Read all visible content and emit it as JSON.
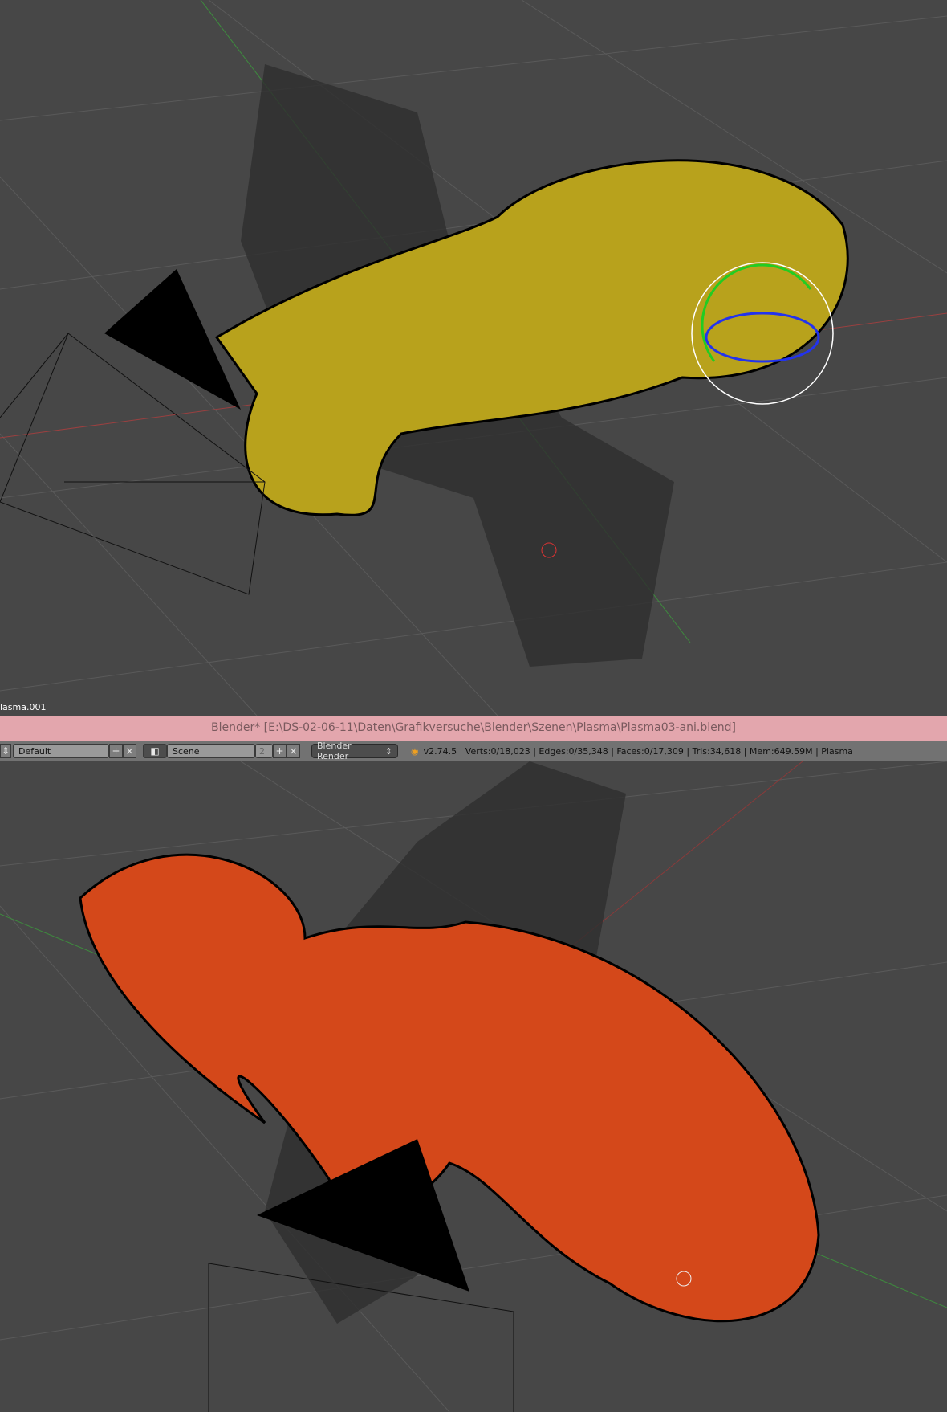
{
  "viewport_top": {
    "object_label": "lasma.001"
  },
  "titlebar": {
    "title": "Blender* [E:\\DS-02-06-11\\Daten\\Grafikversuche\\Blender\\Szenen\\Plasma\\Plasma03-ani.blend]"
  },
  "infobar": {
    "screen_layout": "Default",
    "scene": "Scene",
    "scene_users": "2",
    "render_engine": "Blender Render",
    "stats": "v2.74.5 | Verts:0/18,023 | Edges:0/35,348 | Faces:0/17,309 | Tris:34,618 | Mem:649.59M | Plasma",
    "icons": [
      "screen-layout-icon",
      "add-icon",
      "close-icon",
      "scene-icon",
      "blender-logo-icon"
    ]
  },
  "colors": {
    "viewport_bg": "#474747",
    "titlebar_bg": "#e3a6ad",
    "mesh_yellow": "#b8a21c",
    "mesh_orange": "#d4481a"
  }
}
